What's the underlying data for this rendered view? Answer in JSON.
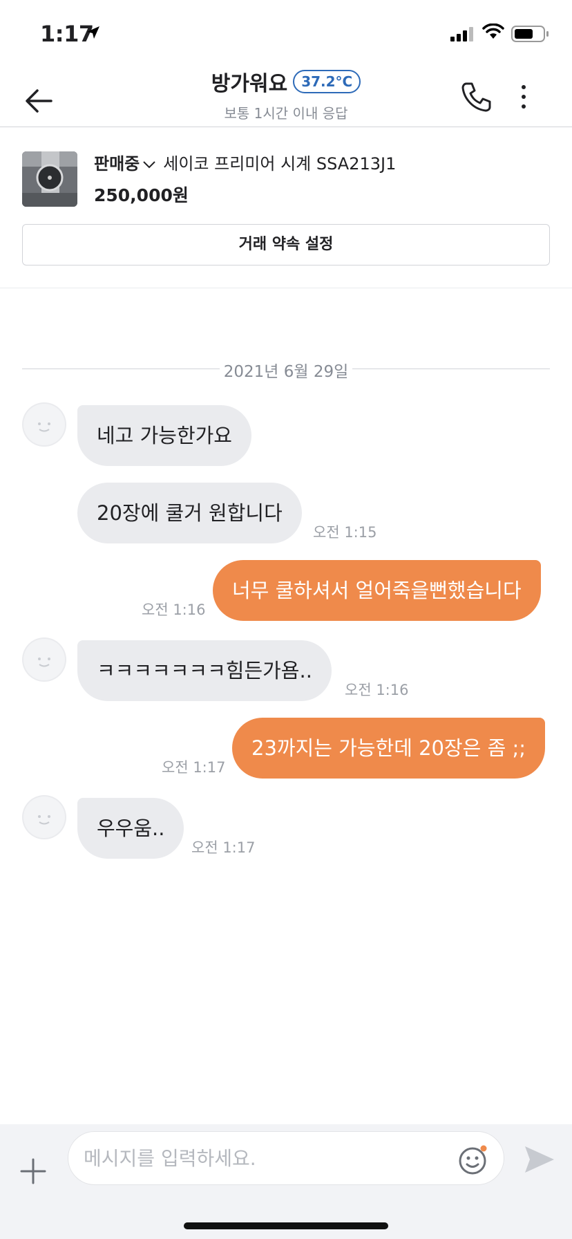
{
  "status_bar": {
    "time": "1:17"
  },
  "header": {
    "peer_name": "방가워요",
    "temperature": "37.2°C",
    "response_time": "보통 1시간 이내 응답"
  },
  "product": {
    "status": "판매중",
    "title": "세이코 프리미어 시계 SSA213J1",
    "price": "250,000원",
    "appointment_button": "거래 약속 설정"
  },
  "chat": {
    "date": "2021년 6월 29일",
    "messages": [
      {
        "sender": "other",
        "text": "네고 가능한가요",
        "time": ""
      },
      {
        "sender": "other",
        "text": "20장에 쿨거 원합니다",
        "time": "오전 1:15"
      },
      {
        "sender": "me",
        "text": "너무 쿨하셔서 얼어죽을뻔했습니다",
        "time": "오전 1:16"
      },
      {
        "sender": "other",
        "text": "ㅋㅋㅋㅋㅋㅋㅋ힘든가욤..",
        "time": "오전 1:16"
      },
      {
        "sender": "me",
        "text": "23까지는 가능한데 20장은 좀 ;;",
        "time": "오전 1:17"
      },
      {
        "sender": "other",
        "text": "우우움..",
        "time": "오전 1:17"
      }
    ]
  },
  "input": {
    "placeholder": "메시지를 입력하세요."
  },
  "colors": {
    "accent": "#ef8a4b",
    "temperature": "#2d6ab8",
    "incoming_bubble": "#eaebee"
  }
}
